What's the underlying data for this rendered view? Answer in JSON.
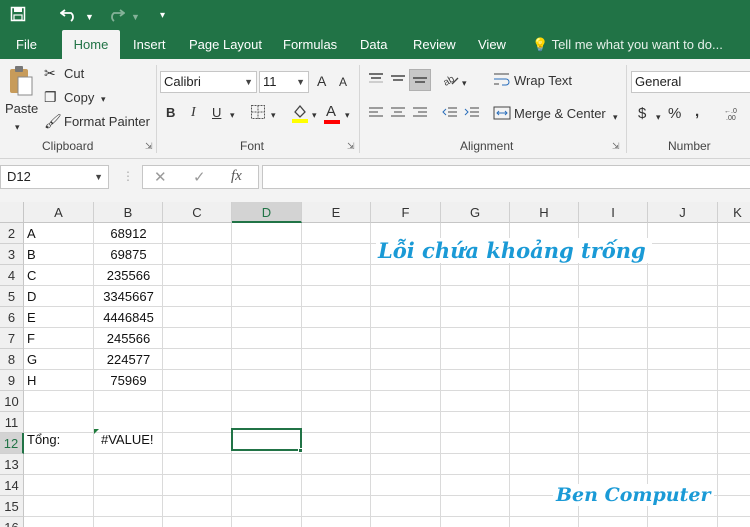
{
  "qat": {
    "save_icon": "save-icon",
    "undo_icon": "undo-icon",
    "redo_icon": "redo-icon",
    "customize_icon": "customize-icon"
  },
  "tabs": [
    "File",
    "Home",
    "Insert",
    "Page Layout",
    "Formulas",
    "Data",
    "Review",
    "View"
  ],
  "active_tab": "Home",
  "tell_me": "Tell me what you want to do...",
  "ribbon": {
    "clipboard": {
      "label": "Clipboard",
      "paste": "Paste",
      "cut": "Cut",
      "copy": "Copy",
      "format_painter": "Format Painter"
    },
    "font": {
      "label": "Font",
      "name": "Calibri",
      "size": "11",
      "bold": "B",
      "italic": "I",
      "underline": "U",
      "grow": "A",
      "shrink": "A",
      "font_color": "A"
    },
    "alignment": {
      "label": "Alignment",
      "wrap_text": "Wrap Text",
      "merge_center": "Merge & Center"
    },
    "number": {
      "label": "Number",
      "format": "General",
      "currency": "$",
      "percent": "%",
      "comma": ","
    }
  },
  "formula_bar": {
    "name_box": "D12",
    "cancel": "✕",
    "enter": "✓",
    "fx": "fx",
    "formula": ""
  },
  "columns": [
    "A",
    "B",
    "C",
    "D",
    "E",
    "F",
    "G",
    "H",
    "I",
    "J",
    "K"
  ],
  "selected_column": "D",
  "rows": [
    "2",
    "3",
    "4",
    "5",
    "6",
    "7",
    "8",
    "9",
    "10",
    "11",
    "12",
    "13",
    "14",
    "15",
    "16"
  ],
  "selected_row": "12",
  "data": [
    {
      "row": "2",
      "a": "A",
      "b": "68912"
    },
    {
      "row": "3",
      "a": "B",
      "b": "69875"
    },
    {
      "row": "4",
      "a": "C",
      "b": "235566"
    },
    {
      "row": "5",
      "a": "D",
      "b": "3345667"
    },
    {
      "row": "6",
      "a": "E",
      "b": "4446845"
    },
    {
      "row": "7",
      "a": "F",
      "b": "245566"
    },
    {
      "row": "8",
      "a": "G",
      "b": "224577"
    },
    {
      "row": "9",
      "a": "H",
      "b": "75969"
    }
  ],
  "total": {
    "label": "Tổng:",
    "value": "#VALUE!"
  },
  "overlay": {
    "title": "Lỗi chứa khoảng trống",
    "watermark": "Ben Computer"
  },
  "colors": {
    "excel_green": "#217346",
    "overlay_blue": "#1a9ad6",
    "error_triangle": "#1e7b3c"
  }
}
